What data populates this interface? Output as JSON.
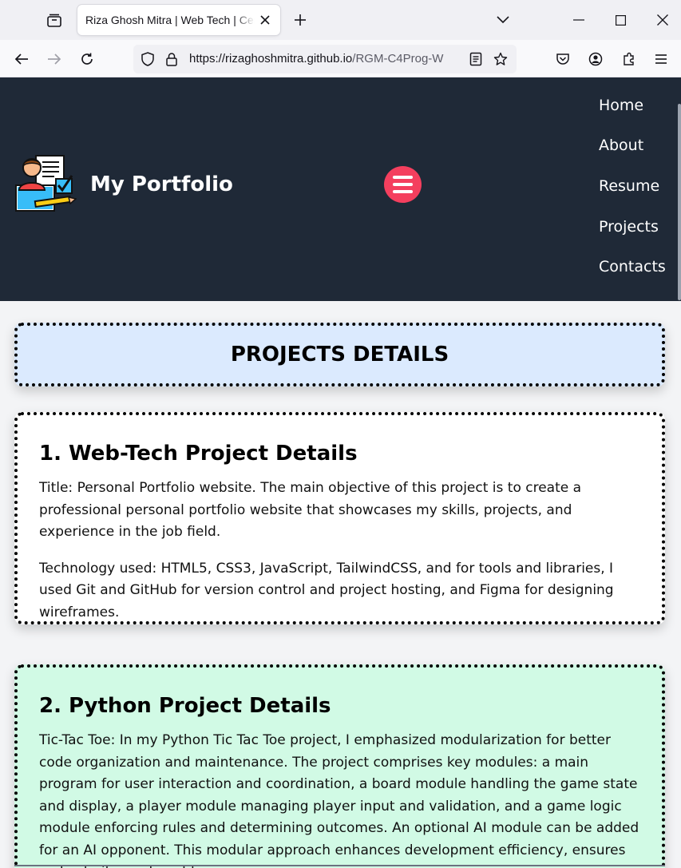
{
  "browser": {
    "tab_title": "Riza Ghosh Mitra | Web Tech | Cert",
    "url_host": "https://rizaghoshmitra.github.io",
    "url_path": "/RGM-C4Prog-W"
  },
  "header": {
    "brand": "My Portfolio",
    "menu": [
      "Home",
      "About",
      "Resume",
      "Projects",
      "Contacts"
    ]
  },
  "page": {
    "heading": "PROJECTS DETAILS",
    "projects": [
      {
        "title": "1. Web-Tech Project Details",
        "paragraphs": [
          "Title: Personal Portfolio website. The main objective of this project is to create a professional personal portfolio website that showcases my skills, projects, and experience in the job field.",
          "Technology used: HTML5, CSS3, JavaScript, TailwindCSS, and for tools and libraries, I used Git and GitHub for version control and project hosting, and Figma for designing wireframes."
        ]
      },
      {
        "title": "2. Python Project Details",
        "paragraphs": [
          "Tic-Tac Toe: In my Python Tic Tac Toe project, I emphasized modularization for better code organization and maintenance. The project comprises key modules: a main program for user interaction and coordination, a board module handling the game state and display, a player module managing player input and validation, and a game logic module enforcing rules and determining outcomes. An optional AI module can be added for an AI opponent. This modular approach enhances development efficiency, ensures code clarity, and enables"
        ]
      }
    ]
  },
  "colors": {
    "header_bg": "#1f2937",
    "hamburger": "#f43f5e",
    "heading_card_bg": "#dbeafe",
    "python_card_bg": "#d1fae5"
  }
}
